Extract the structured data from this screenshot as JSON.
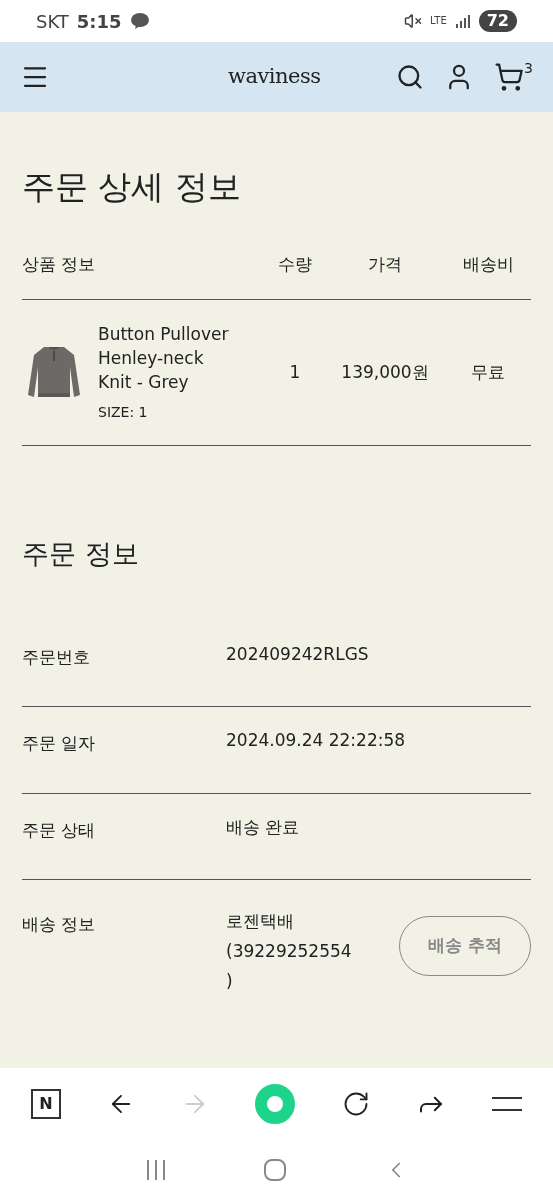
{
  "status_bar": {
    "carrier": "SKT",
    "time": "5:15",
    "network": "LTE",
    "battery": "72"
  },
  "header": {
    "logo": "waviness",
    "cart_count": "3"
  },
  "title": "주문 상세 정보",
  "product_table": {
    "columns": [
      "상품 정보",
      "수량",
      "가격",
      "배송비"
    ],
    "rows": [
      {
        "image": {
          "kind": "picture"
        },
        "name_lines": [
          "Button Pullover",
          "Henley-neck",
          "Knit - Grey"
        ],
        "option": "SIZE: 1",
        "quantity": "1",
        "price": "139,000원",
        "shipping": "무료"
      }
    ]
  },
  "order_info": {
    "title": "주문 정보",
    "rows": [
      {
        "label": "주문번호",
        "value_lines": [
          "202409242RLGS"
        ]
      },
      {
        "label": "주문 일자",
        "value_lines": [
          "2024.09.24 22:22:58"
        ]
      },
      {
        "label": "주문 상태",
        "value_lines": [
          "배송 완료"
        ]
      },
      {
        "label": "배송 정보",
        "value_lines": [
          "로젠택배",
          "(39229252554",
          ")"
        ],
        "button": "배송 추적"
      }
    ]
  },
  "browser_bar": {
    "home_letter": "N",
    "forward_disabled": true
  }
}
